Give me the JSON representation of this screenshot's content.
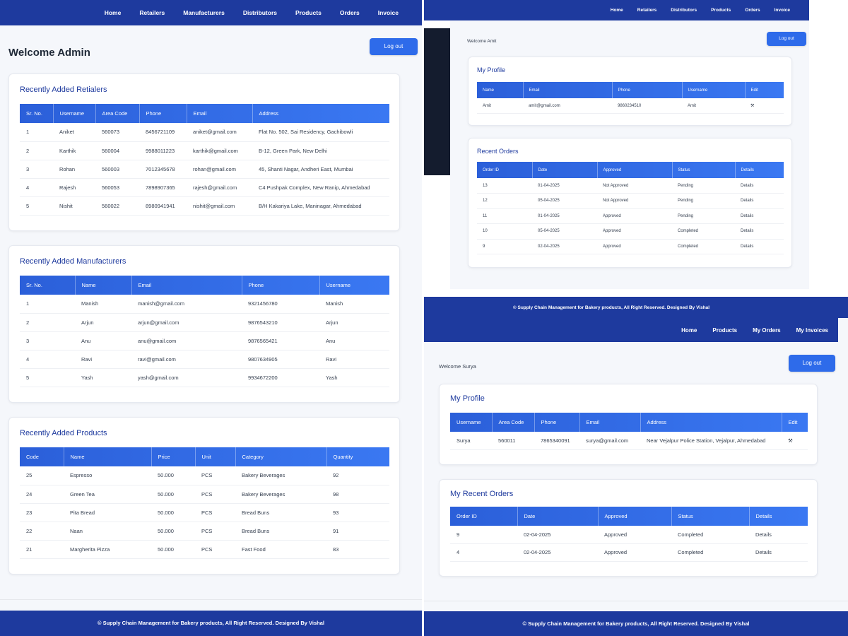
{
  "admin": {
    "nav": [
      "Home",
      "Retailers",
      "Manufacturers",
      "Distributors",
      "Products",
      "Orders",
      "Invoice"
    ],
    "welcome": "Welcome Admin",
    "logout": "Log out",
    "retailers": {
      "title": "Recently Added Retialers",
      "headers": [
        "Sr. No.",
        "Username",
        "Area Code",
        "Phone",
        "Email",
        "Address"
      ],
      "rows": [
        [
          "1",
          "Aniket",
          "560073",
          "8456721109",
          "aniket@gmail.com",
          "Flat No. 502, Sai Residency, Gachibowli"
        ],
        [
          "2",
          "Karthik",
          "560004",
          "9988011223",
          "karthik@gmail.com",
          "B-12, Green Park, New Delhi"
        ],
        [
          "3",
          "Rohan",
          "560003",
          "7012345678",
          "rohan@gmail.com",
          "45, Shanti Nagar, Andheri East, Mumbai"
        ],
        [
          "4",
          "Rajesh",
          "560053",
          "7898907365",
          "rajesh@gmail.com",
          "C4 Pushpak Complex, New Ranip, Ahmedabad"
        ],
        [
          "5",
          "Nishit",
          "560022",
          "8980941941",
          "nishit@gmail.com",
          "B/H Kakariya Lake, Maninagar, Ahmedabad"
        ]
      ]
    },
    "manufacturers": {
      "title": "Recently Added Manufacturers",
      "headers": [
        "Sr. No.",
        "Name",
        "Email",
        "Phone",
        "Username"
      ],
      "rows": [
        [
          "1",
          "Manish",
          "manish@gmail.com",
          "9321456780",
          "Manish"
        ],
        [
          "2",
          "Arjun",
          "arjun@gmail.com",
          "9876543210",
          "Arjun"
        ],
        [
          "3",
          "Anu",
          "anu@gmail.com",
          "9876565421",
          "Anu"
        ],
        [
          "4",
          "Ravi",
          "ravi@gmail.com",
          "9807634905",
          "Ravi"
        ],
        [
          "5",
          "Yash",
          "yash@gmail.com",
          "9934672200",
          "Yash"
        ]
      ]
    },
    "products": {
      "title": "Recently Added Products",
      "headers": [
        "Code",
        "Name",
        "Price",
        "Unit",
        "Category",
        "Quantity"
      ],
      "rows": [
        [
          "25",
          "Espresso",
          "50.000",
          "PCS",
          "Bakery Beverages",
          "92"
        ],
        [
          "24",
          "Green Tea",
          "50.000",
          "PCS",
          "Bakery Beverages",
          "98"
        ],
        [
          "23",
          "Pita Bread",
          "50.000",
          "PCS",
          "Bread Buns",
          "93"
        ],
        [
          "22",
          "Naan",
          "50.000",
          "PCS",
          "Bread Buns",
          "91"
        ],
        [
          "21",
          "Margherita Pizza",
          "50.000",
          "PCS",
          "Fast Food",
          "83"
        ]
      ]
    },
    "footer": "© Supply Chain Management for Bakery products, All Right Reserved. Designed By Vishal"
  },
  "amit": {
    "nav": [
      "Home",
      "Retailers",
      "Distributors",
      "Products",
      "Orders",
      "Invoice"
    ],
    "welcome": "Welcome Amit",
    "logout": "Log out",
    "profile": {
      "title": "My Profile",
      "headers": [
        "Name",
        "Email",
        "Phone",
        "Username",
        "Edit"
      ],
      "rows": [
        [
          "Amit",
          "amit@gmail.com",
          "9860234510",
          "Amit",
          "⚒"
        ]
      ]
    },
    "orders": {
      "title": "Recent Orders",
      "headers": [
        "Order ID",
        "Date",
        "Approved",
        "Status",
        "Details"
      ],
      "rows": [
        [
          "13",
          "01-04-2025",
          "Not Approved",
          "Pending",
          "Details"
        ],
        [
          "12",
          "05-04-2025",
          "Not Approved",
          "Pending",
          "Details"
        ],
        [
          "11",
          "01-04-2025",
          "Approved",
          "Pending",
          "Details"
        ],
        [
          "10",
          "05-04-2025",
          "Approved",
          "Completed",
          "Details"
        ],
        [
          "9",
          "02-04-2025",
          "Approved",
          "Completed",
          "Details"
        ]
      ]
    }
  },
  "surya": {
    "banner": "© Supply Chain Management for Bakery products, All Right Reserved. Designed By Vishal",
    "nav": [
      "Home",
      "Products",
      "My Orders",
      "My Invoices"
    ],
    "welcome": "Welcome Surya",
    "logout": "Log out",
    "profile": {
      "title": "My Profile",
      "headers": [
        "Username",
        "Area Code",
        "Phone",
        "Email",
        "Address",
        "Edit"
      ],
      "rows": [
        [
          "Surya",
          "560011",
          "7865340091",
          "surya@gmail.com",
          "Near Vejalpur Police Station, Vejalpur, Ahmedabad",
          "⚒"
        ]
      ]
    },
    "orders": {
      "title": "My Recent Orders",
      "headers": [
        "Order ID",
        "Date",
        "Approved",
        "Status",
        "Details"
      ],
      "rows": [
        [
          "9",
          "02-04-2025",
          "Approved",
          "Completed",
          "Details"
        ],
        [
          "4",
          "02-04-2025",
          "Approved",
          "Completed",
          "Details"
        ]
      ]
    },
    "footer": "© Supply Chain Management for Bakery products, All Right Reserved. Designed By Vishal"
  }
}
